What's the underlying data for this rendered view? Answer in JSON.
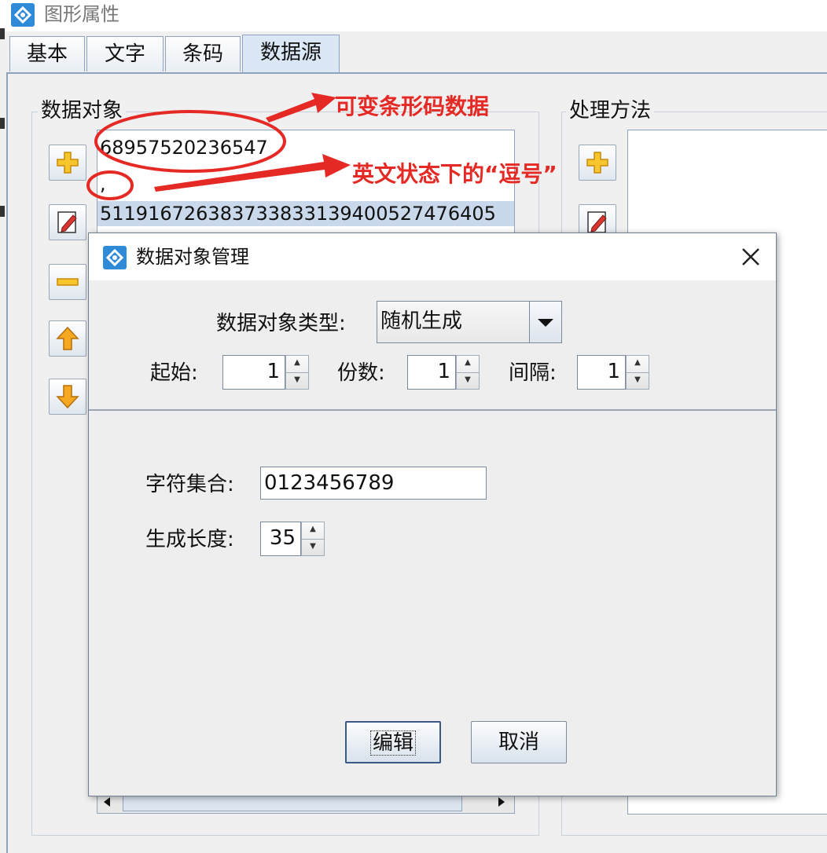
{
  "window": {
    "title": "图形属性"
  },
  "tabs": [
    {
      "label": "基本"
    },
    {
      "label": "文字"
    },
    {
      "label": "条码"
    },
    {
      "label": "数据源"
    }
  ],
  "data_objects": {
    "group_title": "数据对象",
    "items": [
      "68957520236547",
      ",",
      "5119167263837338331394005274764​05"
    ]
  },
  "processing": {
    "group_title": "处理方法"
  },
  "annotations": {
    "variable_barcode": "可变条形码数据",
    "comma_note": "英文状态下的“逗号”"
  },
  "dialog": {
    "title": "数据对象管理",
    "type_label": "数据对象类型:",
    "type_value": "随机生成",
    "start_label": "起始:",
    "start_value": "1",
    "copies_label": "份数:",
    "copies_value": "1",
    "interval_label": "间隔:",
    "interval_value": "1",
    "charset_label": "字符集合:",
    "charset_value": "0123456789",
    "length_label": "生成长度:",
    "length_value": "35",
    "edit_button": "编辑",
    "cancel_button": "取消"
  },
  "colors": {
    "annotation": "#e52a25",
    "selection": "#c9d8ea",
    "app_icon": "#2f8ad8"
  }
}
